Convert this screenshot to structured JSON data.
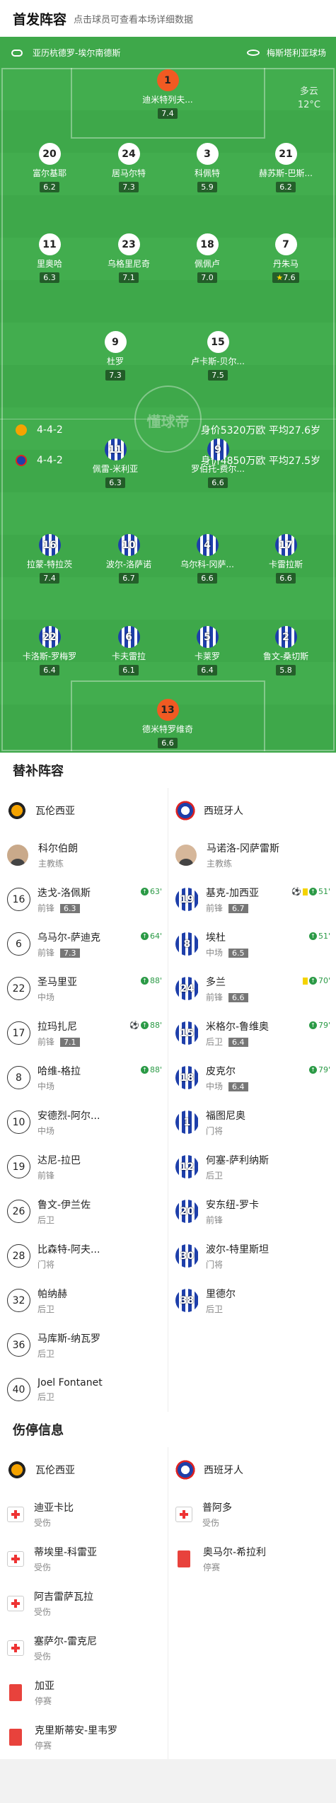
{
  "header": {
    "title": "首发阵容",
    "subtitle": "点击球员可查看本场详细数据"
  },
  "pitch": {
    "stadium": "亚历杭德罗-埃尔南德斯",
    "referee": "梅斯塔利亚球场",
    "weather": "多云",
    "temp": "12°C",
    "home_formation": "4-4-2",
    "home_value": "身价5320万欧 平均27.6岁",
    "away_formation": "4-4-2",
    "away_value": "身价4850万欧 平均27.5岁",
    "watermark": "懂球帝"
  },
  "home_players": [
    {
      "num": "1",
      "name": "迪米特列夫...",
      "rating": "7.4",
      "gk": true
    },
    {
      "num": "20",
      "name": "富尔基耶",
      "rating": "6.2"
    },
    {
      "num": "24",
      "name": "居马尔特",
      "rating": "7.3",
      "ball": true
    },
    {
      "num": "3",
      "name": "科佩特",
      "rating": "5.9",
      "ball": true
    },
    {
      "num": "21",
      "name": "赫苏斯-巴斯...",
      "rating": "6.2",
      "card": true
    },
    {
      "num": "11",
      "name": "里奥哈",
      "rating": "6.3",
      "sub": "88'"
    },
    {
      "num": "23",
      "name": "乌格里尼奇",
      "rating": "7.1",
      "sub": "88'"
    },
    {
      "num": "18",
      "name": "佩佩卢",
      "rating": "7.0",
      "sub": "88'",
      "captain": true
    },
    {
      "num": "7",
      "name": "丹朱马",
      "rating": "7.6",
      "sub": "63'",
      "star": true
    },
    {
      "num": "9",
      "name": "杜罗",
      "rating": "7.3",
      "sub": "64'",
      "ball": true
    },
    {
      "num": "15",
      "name": "卢卡斯-贝尔...",
      "rating": "7.5",
      "ball": true
    }
  ],
  "away_players": [
    {
      "num": "11",
      "name": "佩雷-米利亚",
      "rating": "6.3",
      "sub": "51'"
    },
    {
      "num": "9",
      "name": "罗伯托-费尔...",
      "rating": "6.6"
    },
    {
      "num": "16",
      "name": "拉蒙-特拉茨",
      "rating": "7.4",
      "sub": "79'",
      "ball": true
    },
    {
      "num": "10",
      "name": "波尔-洛萨诺",
      "rating": "6.7",
      "sub": "51'",
      "card": true
    },
    {
      "num": "4",
      "name": "乌尔科-冈萨...",
      "rating": "6.6"
    },
    {
      "num": "17",
      "name": "卡雷拉斯",
      "rating": "6.6",
      "sub": "70'"
    },
    {
      "num": "22",
      "name": "卡洛斯-罗梅罗",
      "rating": "6.4"
    },
    {
      "num": "6",
      "name": "卡夫雷拉",
      "rating": "6.1",
      "captain": true
    },
    {
      "num": "5",
      "name": "卡莱罗",
      "rating": "6.4",
      "sub": "79'",
      "card": true
    },
    {
      "num": "2",
      "name": "鲁文-桑切斯",
      "rating": "5.8",
      "card": true
    },
    {
      "num": "13",
      "name": "德米特罗维奇",
      "rating": "6.6",
      "gk": true
    }
  ],
  "subs": {
    "title": "替补阵容",
    "home_team": "瓦伦西亚",
    "away_team": "西班牙人",
    "home_coach": "科尔伯朗",
    "away_coach": "马诺洛-冈萨雷斯",
    "coach_label": "主教练",
    "home": [
      {
        "num": "16",
        "name": "迭戈-洛佩斯",
        "pos": "前锋",
        "rating": "6.3",
        "time": "63'",
        "up": true
      },
      {
        "num": "6",
        "name": "乌马尔-萨迪克",
        "pos": "前锋",
        "rating": "7.3",
        "time": "64'",
        "up": true
      },
      {
        "num": "22",
        "name": "圣马里亚",
        "pos": "中场",
        "time": "88'",
        "up": true
      },
      {
        "num": "17",
        "name": "拉玛扎尼",
        "pos": "前锋",
        "rating": "7.1",
        "time": "88'",
        "up": true,
        "ball": true
      },
      {
        "num": "8",
        "name": "哈维-格拉",
        "pos": "中场",
        "time": "88'",
        "up": true
      },
      {
        "num": "10",
        "name": "安德烈-阿尔...",
        "pos": "中场"
      },
      {
        "num": "19",
        "name": "达尼-拉巴",
        "pos": "前锋"
      },
      {
        "num": "26",
        "name": "鲁文-伊兰佐",
        "pos": "后卫"
      },
      {
        "num": "28",
        "name": "比森特-阿夫...",
        "pos": "门将"
      },
      {
        "num": "32",
        "name": "帕纳赫",
        "pos": "后卫"
      },
      {
        "num": "36",
        "name": "马库斯-纳瓦罗",
        "pos": "后卫"
      },
      {
        "num": "40",
        "name": "Joel Fontanet",
        "pos": "后卫"
      }
    ],
    "away": [
      {
        "num": "19",
        "name": "基克-加西亚",
        "pos": "前锋",
        "rating": "6.7",
        "time": "51'",
        "up": true,
        "card": true,
        "ball": true
      },
      {
        "num": "8",
        "name": "埃杜",
        "pos": "中场",
        "rating": "6.5",
        "time": "51'",
        "up": true
      },
      {
        "num": "24",
        "name": "多兰",
        "pos": "前锋",
        "rating": "6.6",
        "time": "70'",
        "up": true,
        "card": true
      },
      {
        "num": "15",
        "name": "米格尔-鲁维奥",
        "pos": "后卫",
        "rating": "6.4",
        "time": "79'",
        "up": true
      },
      {
        "num": "18",
        "name": "皮克尔",
        "pos": "中场",
        "rating": "6.4",
        "time": "79'",
        "up": true
      },
      {
        "num": "1",
        "name": "福图尼奥",
        "pos": "门将"
      },
      {
        "num": "12",
        "name": "何塞-萨利纳斯",
        "pos": "后卫"
      },
      {
        "num": "20",
        "name": "安东纽-罗卡",
        "pos": "前锋"
      },
      {
        "num": "30",
        "name": "波尔-特里斯坦",
        "pos": "门将"
      },
      {
        "num": "38",
        "name": "里德尔",
        "pos": "后卫"
      }
    ]
  },
  "injuries": {
    "title": "伤停信息",
    "home_team": "瓦伦西亚",
    "away_team": "西班牙人",
    "home": [
      {
        "name": "迪亚卡比",
        "status": "受伤",
        "type": "injury"
      },
      {
        "name": "蒂埃里-科雷亚",
        "status": "受伤",
        "type": "injury"
      },
      {
        "name": "阿吉雷萨瓦拉",
        "status": "受伤",
        "type": "injury"
      },
      {
        "name": "塞萨尔-雷克尼",
        "status": "受伤",
        "type": "injury"
      },
      {
        "name": "加亚",
        "status": "停赛",
        "type": "red"
      },
      {
        "name": "克里斯蒂安-里韦罗",
        "status": "停赛",
        "type": "red"
      }
    ],
    "away": [
      {
        "name": "普阿多",
        "status": "受伤",
        "type": "injury"
      },
      {
        "name": "奥马尔-希拉利",
        "status": "停赛",
        "type": "red"
      }
    ]
  }
}
